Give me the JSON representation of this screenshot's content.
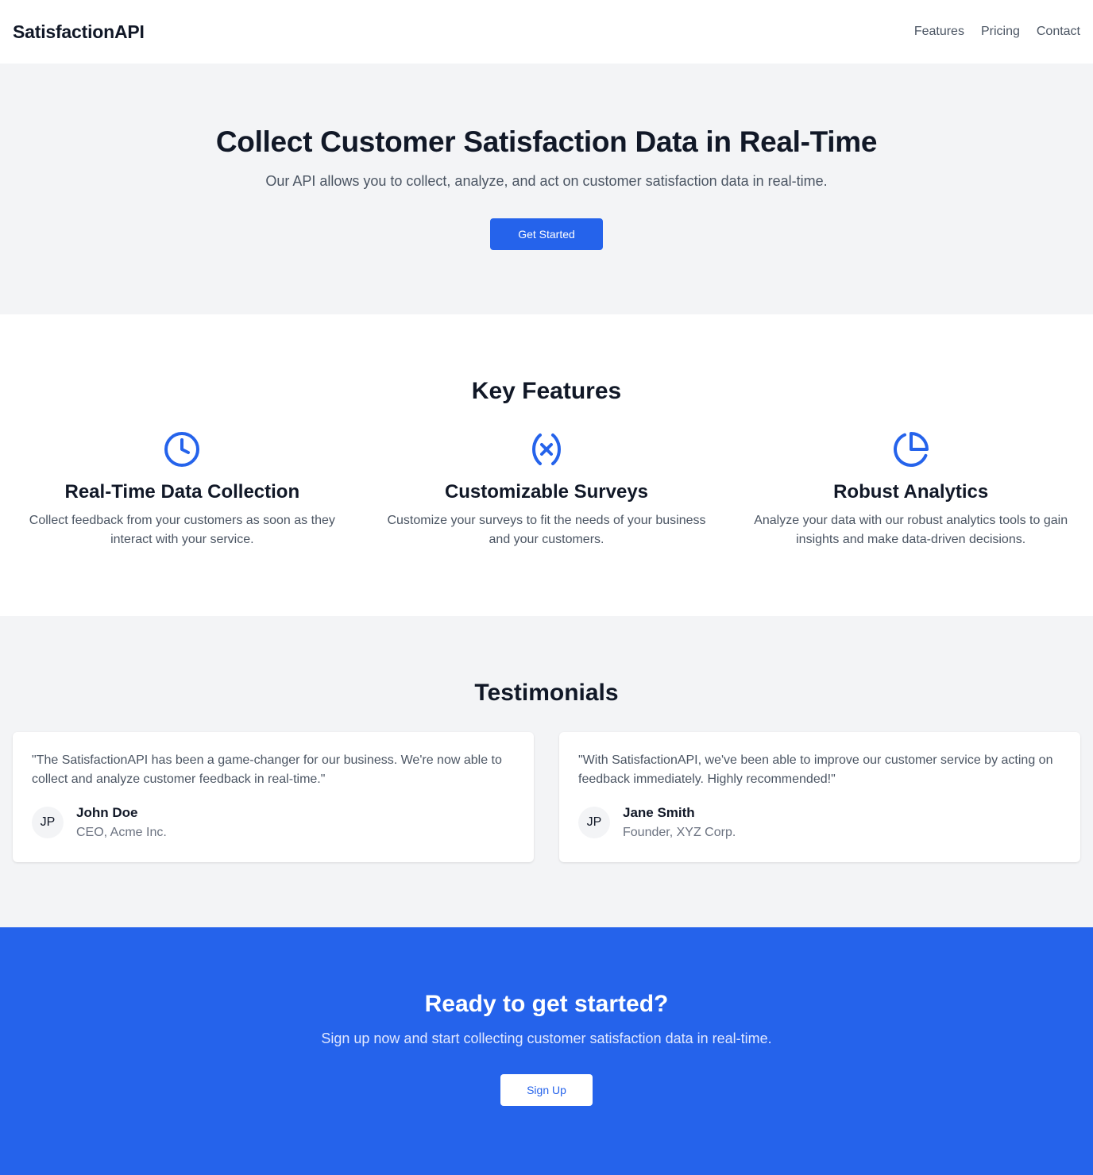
{
  "brand": {
    "name": "SatisfactionAPI",
    "accent": "#2563eb"
  },
  "nav": {
    "items": [
      "Features",
      "Pricing",
      "Contact"
    ]
  },
  "hero": {
    "title": "Collect Customer Satisfaction Data in Real-Time",
    "subtitle": "Our API allows you to collect, analyze, and act on customer satisfaction data in real-time.",
    "cta_label": "Get Started"
  },
  "features": {
    "title": "Key Features",
    "items": [
      {
        "icon": "clock-icon",
        "title": "Real-Time Data Collection",
        "description": "Collect feedback from your customers as soon as they interact with your service."
      },
      {
        "icon": "variable-icon",
        "title": "Customizable Surveys",
        "description": "Customize your surveys to fit the needs of your business and your customers."
      },
      {
        "icon": "pie-chart-icon",
        "title": "Robust Analytics",
        "description": "Analyze your data with our robust analytics tools to gain insights and make data-driven decisions."
      }
    ]
  },
  "testimonials": {
    "title": "Testimonials",
    "items": [
      {
        "quote": "\"The SatisfactionAPI has been a game-changer for our business. We're now able to collect and analyze customer feedback in real-time.\"",
        "initials": "JP",
        "name": "John Doe",
        "role": "CEO, Acme Inc."
      },
      {
        "quote": "\"With SatisfactionAPI, we've been able to improve our customer service by acting on feedback immediately. Highly recommended!\"",
        "initials": "JP",
        "name": "Jane Smith",
        "role": "Founder, XYZ Corp."
      }
    ]
  },
  "cta": {
    "title": "Ready to get started?",
    "subtitle": "Sign up now and start collecting customer satisfaction data in real-time.",
    "button_label": "Sign Up"
  }
}
